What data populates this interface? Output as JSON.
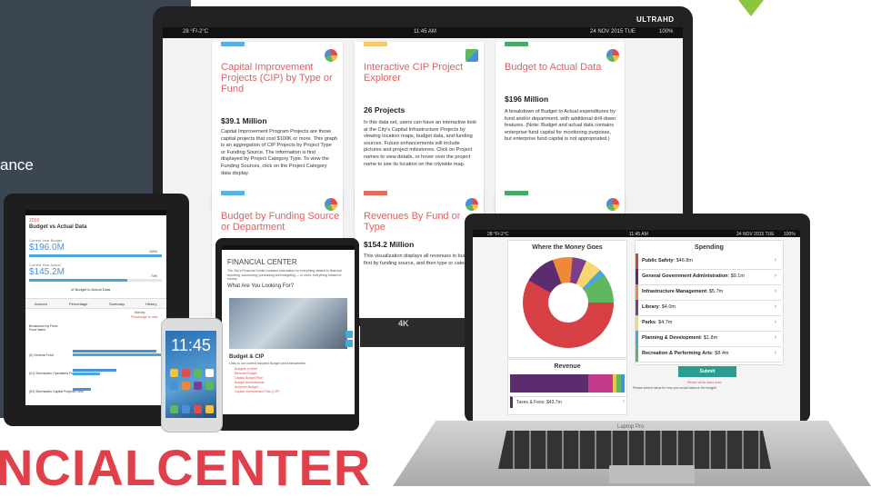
{
  "background": {
    "left_text": "ance",
    "brand_text": "NCIALCENTER"
  },
  "monitor": {
    "badge": "ULTRAHD",
    "status": {
      "left": "28 °F/-2°C",
      "center": "11:45 AM",
      "right": "24 NOV 2015 TUE",
      "battery": "100%"
    },
    "stand_label": "4K",
    "cards": [
      {
        "title": "Capital Improvement Projects (CIP) by Type or Fund",
        "amount": "$39.1 Million",
        "description": "Capital Improvement Program Projects are those capital projects that cost $100K or more. This graph is an aggregation of CIP Projects by Project Type or Funding Source. The information is first displayed by Project Category Type. To view the Funding Sources, click on the Project Category data display.",
        "color": "#5ab0e0",
        "icon": "pie-chart-icon"
      },
      {
        "title": "Interactive CIP Project Explorer",
        "amount": "26 Projects",
        "description": "In this data set, users can have an interactive look at the City's Capital Infrastructure Projects by viewing location maps, budget data, and funding sources. Future enhancements will include pictures and project milestones. Click on Project names to view details, or hover over the project name to see its location on the citywide map.",
        "color": "#f3c96a",
        "icon": "map-icon"
      },
      {
        "title": "Budget to Actual Data",
        "amount": "$196 Million",
        "description": "A breakdown of Budget to Actual expenditures by fund and/or department, with additional drill-down features. (Note: Budget and actual data contains enterprise fund capital for monitoring purposes, but enterprise fund capital is not appropriated.)",
        "color": "#4aa86a",
        "icon": "pie-chart-icon"
      },
      {
        "title": "Budget by Funding Source or Department",
        "amount": "",
        "description": "",
        "color": "#5ab0e0",
        "icon": "pie-chart-icon"
      },
      {
        "title": "Revenues By Fund or Type",
        "amount": "$154.2 Million",
        "description": "This visualization displays all revenues in budget, first by funding source, and then type or category.",
        "color": "#e07060",
        "icon": "pie-chart-icon"
      },
      {
        "title": "",
        "amount": "",
        "description": "",
        "color": "#4aa86a",
        "icon": "pie-chart-icon"
      }
    ]
  },
  "tablet_left": {
    "year": "2016",
    "title": "Budget vs Actual Data",
    "current_budget_label": "Current Year Budget",
    "current_budget_value": "$196.0M",
    "current_actual_label": "Current Year Actual",
    "current_actual_value": "$145.2M",
    "budget_pct": "100%",
    "actual_pct": "74%",
    "link": "of Budget to Actual Data",
    "tabs": [
      "Amount",
      "Percentage",
      "Summary",
      "History"
    ],
    "sort_label": "Sort by:",
    "sort_value": "Percentage to date",
    "breakdown_label": "Breakdown by Fund: Fund Name",
    "rows": [
      "(0) General Fund",
      "(01) Stormwater Operations Fund",
      "(02) Stormwater Capital Projects Fund"
    ]
  },
  "phone": {
    "time": "11:45"
  },
  "tablet_mid": {
    "header": "FINANCIAL CENTER",
    "intro": "The City's Financial Center contains information on everything related to financial reporting, accounting, purchasing and budgeting — in short, everything related to money.",
    "question": "What Are You Looking For?",
    "section": "Budget & CIP",
    "section_desc": "Links to our current Adopted Budget and Amendments.",
    "links": [
      "Budgets in Brief",
      "Biennial Budget",
      "Capital Budget Plan",
      "Budget Amendments",
      "Archived Budget",
      "Capital Improvement Plan (CIP)"
    ]
  },
  "laptop": {
    "status": {
      "left": "28 °F/-2°C",
      "center": "11:45 AM",
      "right": "24 NOV 2015 TUE",
      "battery": "100%"
    },
    "money_title": "Where the Money Goes",
    "revenue_title": "Revenue",
    "revenue_row": "Taxes & Fees: $43.7m",
    "spending_title": "Spending",
    "spending": [
      {
        "label": "Public Safety",
        "value": "$46.8m",
        "color": "#d64045"
      },
      {
        "label": "General Government Administration",
        "value": "$9.1m",
        "color": "#5c2d6e"
      },
      {
        "label": "Infrastructure Management",
        "value": "$5.7m",
        "color": "#f0883a"
      },
      {
        "label": "Library",
        "value": "$4.0m",
        "color": "#7a3e8c"
      },
      {
        "label": "Parks",
        "value": "$4.7m",
        "color": "#f5d76e"
      },
      {
        "label": "Planning & Development",
        "value": "$1.8m",
        "color": "#4aa8d8"
      },
      {
        "label": "Recreation & Performing Arts",
        "value": "$8.4m",
        "color": "#5fb85f"
      }
    ],
    "submit_label": "Submit",
    "reset_label": "Reset all to start over",
    "note": "Please submit ideas for how you would balance the budget!",
    "brand": "Laptop Pro"
  }
}
